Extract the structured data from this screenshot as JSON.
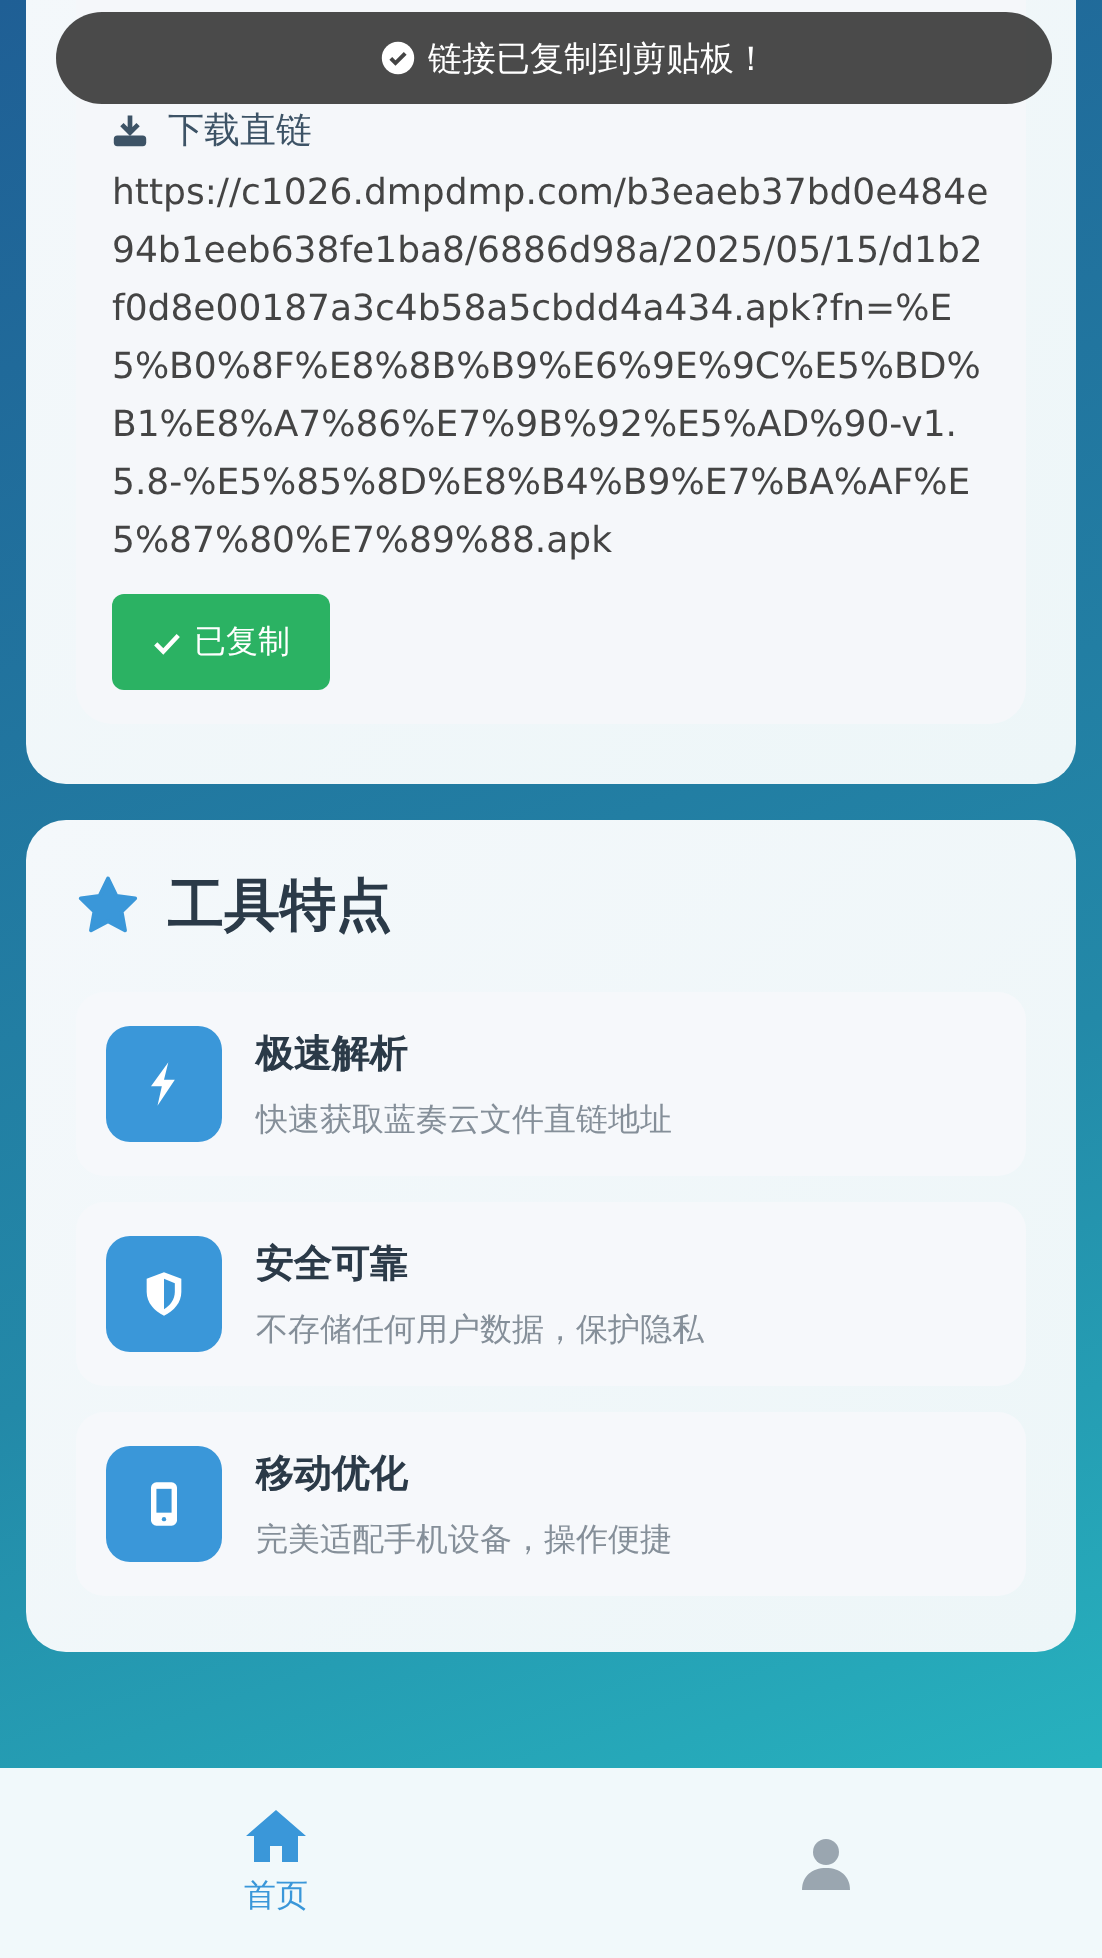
{
  "toast": {
    "text": "链接已复制到剪贴板！"
  },
  "result": {
    "heading": "下载直链",
    "url": "https://c1026.dmpdmp.com/b3eaeb37bd0e484e94b1eeb638fe1ba8/6886d98a/2025/05/15/d1b2f0d8e00187a3c4b58a5cbdd4a434.apk?fn=%E5%B0%8F%E8%8B%B9%E6%9E%9C%E5%BD%B1%E8%A7%86%E7%9B%92%E5%AD%90-v1.5.8-%E5%85%8D%E8%B4%B9%E7%BA%AF%E5%87%80%E7%89%88.apk",
    "copy_button": {
      "label": "已复制",
      "copied": true
    }
  },
  "features": {
    "title": "工具特点",
    "items": [
      {
        "title": "极速解析",
        "description": "快速获取蓝奏云文件直链地址"
      },
      {
        "title": "安全可靠",
        "description": "不存储任何用户数据，保护隐私"
      },
      {
        "title": "移动优化",
        "description": "完美适配手机设备，操作便捷"
      }
    ]
  },
  "bottom_nav": [
    {
      "label": "首页",
      "selected": true
    },
    {
      "selected": false
    }
  ]
}
